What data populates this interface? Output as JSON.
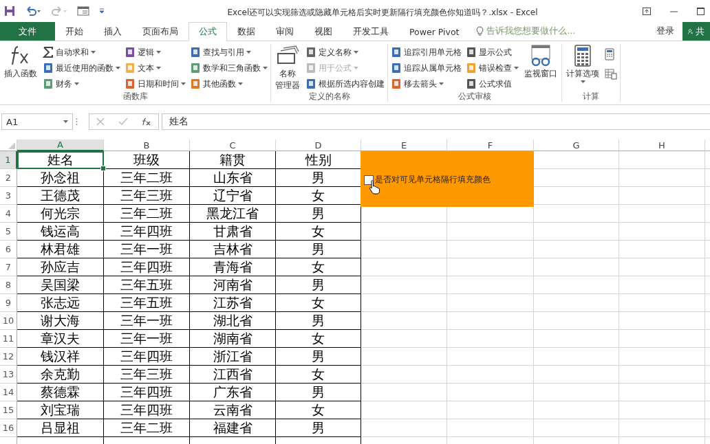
{
  "window": {
    "title": "Excel还可以实现筛选或隐藏单元格后实时更新隔行填充颜色你知道吗？.xlsx - Excel"
  },
  "tabs": [
    {
      "label": "文件",
      "kind": "file",
      "selected": false
    },
    {
      "label": "开始",
      "kind": "tab",
      "selected": false
    },
    {
      "label": "插入",
      "kind": "tab",
      "selected": false
    },
    {
      "label": "页面布局",
      "kind": "tab",
      "selected": false
    },
    {
      "label": "公式",
      "kind": "tab",
      "selected": true
    },
    {
      "label": "数据",
      "kind": "tab",
      "selected": false
    },
    {
      "label": "审阅",
      "kind": "tab",
      "selected": false
    },
    {
      "label": "视图",
      "kind": "tab",
      "selected": false
    },
    {
      "label": "开发工具",
      "kind": "tab",
      "selected": false
    },
    {
      "label": "Power Pivot",
      "kind": "tab",
      "selected": false
    }
  ],
  "tell_me": {
    "placeholder": "告诉我您想要做什么..."
  },
  "sign_in": "登录",
  "share": "共",
  "ribbon": [
    {
      "label": "函数库",
      "controls": [
        {
          "kind": "large",
          "lines": [
            "插入函数"
          ],
          "dropdown": false
        },
        {
          "kind": "stack",
          "items": [
            {
              "label": "自动求和",
              "dropdown": true,
              "disabled": false
            },
            {
              "label": "最近使用的函数",
              "dropdown": true,
              "disabled": false
            },
            {
              "label": "财务",
              "dropdown": true,
              "disabled": false
            }
          ]
        },
        {
          "kind": "stack",
          "items": [
            {
              "label": "逻辑",
              "dropdown": true,
              "disabled": false
            },
            {
              "label": "文本",
              "dropdown": true,
              "disabled": false
            },
            {
              "label": "日期和时间",
              "dropdown": true,
              "disabled": false
            }
          ]
        },
        {
          "kind": "stack",
          "items": [
            {
              "label": "查找与引用",
              "dropdown": true,
              "disabled": false
            },
            {
              "label": "数学和三角函数",
              "dropdown": true,
              "disabled": false
            },
            {
              "label": "其他函数",
              "dropdown": true,
              "disabled": false
            }
          ]
        }
      ]
    },
    {
      "label": "定义的名称",
      "controls": [
        {
          "kind": "large",
          "lines": [
            "名称",
            "管理器"
          ],
          "dropdown": false
        },
        {
          "kind": "stack",
          "items": [
            {
              "label": "定义名称",
              "dropdown": true,
              "disabled": false
            },
            {
              "label": "用于公式",
              "dropdown": true,
              "disabled": true
            },
            {
              "label": "根据所选内容创建",
              "dropdown": false,
              "disabled": false
            }
          ]
        }
      ]
    },
    {
      "label": "公式审核",
      "controls": [
        {
          "kind": "stack",
          "items": [
            {
              "label": "追踪引用单元格",
              "dropdown": false,
              "disabled": false
            },
            {
              "label": "追踪从属单元格",
              "dropdown": false,
              "disabled": false
            },
            {
              "label": "移去箭头",
              "dropdown": true,
              "disabled": false
            }
          ]
        },
        {
          "kind": "stack",
          "items": [
            {
              "label": "显示公式",
              "dropdown": false,
              "disabled": false
            },
            {
              "label": "错误检查",
              "dropdown": true,
              "disabled": false
            },
            {
              "label": "公式求值",
              "dropdown": false,
              "disabled": false
            }
          ]
        },
        {
          "kind": "large",
          "lines": [
            "监视窗口"
          ],
          "dropdown": false
        }
      ]
    },
    {
      "label": "计算",
      "controls": [
        {
          "kind": "large",
          "lines": [
            "计算选项"
          ],
          "dropdown": true
        },
        {
          "kind": "icons"
        }
      ]
    }
  ],
  "formula_bar": {
    "name_box": "A1",
    "value": "姓名"
  },
  "sheet": {
    "columns": [
      {
        "label": "A",
        "selected": true
      },
      {
        "label": "B",
        "selected": false
      },
      {
        "label": "C",
        "selected": false
      },
      {
        "label": "D",
        "selected": false
      },
      {
        "label": "E",
        "selected": false
      },
      {
        "label": "F",
        "selected": false
      },
      {
        "label": "G",
        "selected": false
      },
      {
        "label": "H",
        "selected": false
      }
    ],
    "rows": [
      {
        "number": "1",
        "selected": true,
        "cells": [
          "姓名",
          "班级",
          "籍贯",
          "性别"
        ]
      },
      {
        "number": "2",
        "selected": false,
        "cells": [
          "孙念祖",
          "三年二班",
          "山东省",
          "男"
        ]
      },
      {
        "number": "3",
        "selected": false,
        "cells": [
          "王德茂",
          "三年三班",
          "辽宁省",
          "女"
        ]
      },
      {
        "number": "4",
        "selected": false,
        "cells": [
          "何光宗",
          "三年二班",
          "黑龙江省",
          "男"
        ]
      },
      {
        "number": "5",
        "selected": false,
        "cells": [
          "钱运高",
          "三年四班",
          "甘肃省",
          "女"
        ]
      },
      {
        "number": "6",
        "selected": false,
        "cells": [
          "林君雄",
          "三年一班",
          "吉林省",
          "男"
        ]
      },
      {
        "number": "7",
        "selected": false,
        "cells": [
          "孙应吉",
          "三年四班",
          "青海省",
          "女"
        ]
      },
      {
        "number": "8",
        "selected": false,
        "cells": [
          "吴国梁",
          "三年五班",
          "河南省",
          "男"
        ]
      },
      {
        "number": "9",
        "selected": false,
        "cells": [
          "张志远",
          "三年五班",
          "江苏省",
          "女"
        ]
      },
      {
        "number": "10",
        "selected": false,
        "cells": [
          "谢大海",
          "三年一班",
          "湖北省",
          "男"
        ]
      },
      {
        "number": "11",
        "selected": false,
        "cells": [
          "章汉夫",
          "三年一班",
          "湖南省",
          "女"
        ]
      },
      {
        "number": "12",
        "selected": false,
        "cells": [
          "钱汉祥",
          "三年四班",
          "浙江省",
          "男"
        ]
      },
      {
        "number": "13",
        "selected": false,
        "cells": [
          "余克勤",
          "三年三班",
          "江西省",
          "女"
        ]
      },
      {
        "number": "14",
        "selected": false,
        "cells": [
          "蔡德霖",
          "三年四班",
          "广东省",
          "男"
        ]
      },
      {
        "number": "15",
        "selected": false,
        "cells": [
          "刘宝瑞",
          "三年四班",
          "云南省",
          "女"
        ]
      },
      {
        "number": "16",
        "selected": false,
        "cells": [
          "吕显祖",
          "三年二班",
          "福建省",
          "男"
        ]
      }
    ],
    "checkbox": {
      "label": "是否对可见单元格隔行填充颜色",
      "checked": false
    }
  }
}
